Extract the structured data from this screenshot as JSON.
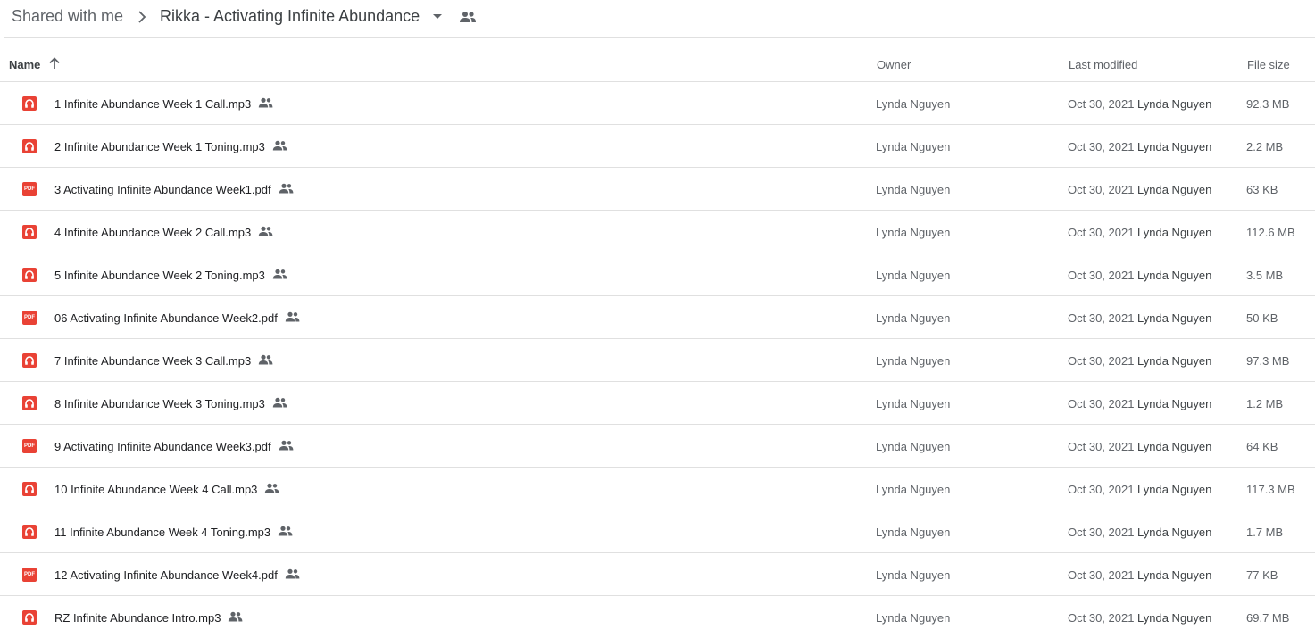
{
  "breadcrumb": {
    "parent": "Shared with me",
    "current": "Rikka - Activating Infinite Abundance"
  },
  "columns": {
    "name": "Name",
    "owner": "Owner",
    "last_modified": "Last modified",
    "file_size": "File size"
  },
  "colors": {
    "file_icon": "#e94235",
    "divider": "#e0e0e0"
  },
  "files": [
    {
      "name": "1 Infinite Abundance Week 1 Call.mp3",
      "type": "audio",
      "owner": "Lynda Nguyen",
      "modified_date": "Oct 30, 2021",
      "modified_by": "Lynda Nguyen",
      "size": "92.3 MB"
    },
    {
      "name": "2 Infinite Abundance Week 1 Toning.mp3",
      "type": "audio",
      "owner": "Lynda Nguyen",
      "modified_date": "Oct 30, 2021",
      "modified_by": "Lynda Nguyen",
      "size": "2.2 MB"
    },
    {
      "name": "3 Activating Infinite Abundance Week1.pdf",
      "type": "pdf",
      "owner": "Lynda Nguyen",
      "modified_date": "Oct 30, 2021",
      "modified_by": "Lynda Nguyen",
      "size": "63 KB"
    },
    {
      "name": "4 Infinite Abundance Week 2 Call.mp3",
      "type": "audio",
      "owner": "Lynda Nguyen",
      "modified_date": "Oct 30, 2021",
      "modified_by": "Lynda Nguyen",
      "size": "112.6 MB"
    },
    {
      "name": "5 Infinite Abundance Week 2 Toning.mp3",
      "type": "audio",
      "owner": "Lynda Nguyen",
      "modified_date": "Oct 30, 2021",
      "modified_by": "Lynda Nguyen",
      "size": "3.5 MB"
    },
    {
      "name": "06 Activating Infinite Abundance Week2.pdf",
      "type": "pdf",
      "owner": "Lynda Nguyen",
      "modified_date": "Oct 30, 2021",
      "modified_by": "Lynda Nguyen",
      "size": "50 KB"
    },
    {
      "name": "7 Infinite Abundance Week 3 Call.mp3",
      "type": "audio",
      "owner": "Lynda Nguyen",
      "modified_date": "Oct 30, 2021",
      "modified_by": "Lynda Nguyen",
      "size": "97.3 MB"
    },
    {
      "name": "8 Infinite Abundance Week 3 Toning.mp3",
      "type": "audio",
      "owner": "Lynda Nguyen",
      "modified_date": "Oct 30, 2021",
      "modified_by": "Lynda Nguyen",
      "size": "1.2 MB"
    },
    {
      "name": "9 Activating Infinite Abundance Week3.pdf",
      "type": "pdf",
      "owner": "Lynda Nguyen",
      "modified_date": "Oct 30, 2021",
      "modified_by": "Lynda Nguyen",
      "size": "64 KB"
    },
    {
      "name": "10 Infinite Abundance Week 4 Call.mp3",
      "type": "audio",
      "owner": "Lynda Nguyen",
      "modified_date": "Oct 30, 2021",
      "modified_by": "Lynda Nguyen",
      "size": "117.3 MB"
    },
    {
      "name": "11 Infinite Abundance Week 4 Toning.mp3",
      "type": "audio",
      "owner": "Lynda Nguyen",
      "modified_date": "Oct 30, 2021",
      "modified_by": "Lynda Nguyen",
      "size": "1.7 MB"
    },
    {
      "name": "12 Activating Infinite Abundance Week4.pdf",
      "type": "pdf",
      "owner": "Lynda Nguyen",
      "modified_date": "Oct 30, 2021",
      "modified_by": "Lynda Nguyen",
      "size": "77 KB"
    },
    {
      "name": "RZ Infinite Abundance Intro.mp3",
      "type": "audio",
      "owner": "Lynda Nguyen",
      "modified_date": "Oct 30, 2021",
      "modified_by": "Lynda Nguyen",
      "size": "69.7 MB"
    }
  ],
  "icons": {
    "breadcrumb_separator": "chevron-right-icon",
    "folder_menu": "caret-down-icon",
    "shared_folder": "people-icon",
    "sort": "arrow-up-icon",
    "audio_file": "headphones-icon",
    "pdf_file": "pdf-icon",
    "shared_file": "people-icon"
  }
}
